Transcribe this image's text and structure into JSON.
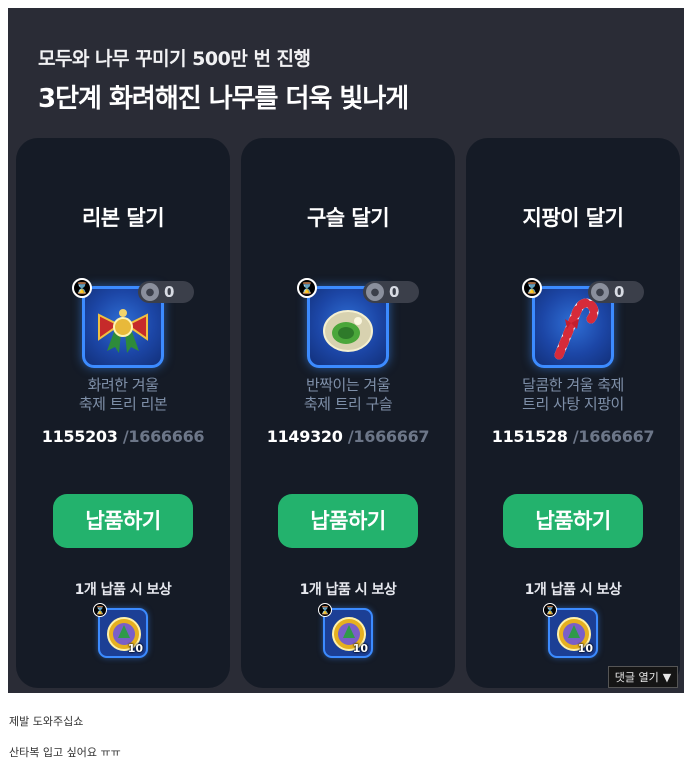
{
  "banner": {
    "subtitle": "모두와 나무 꾸미기 500만 번 진행",
    "title": "3단계 화려해진 나무를 더욱 빛나게"
  },
  "cards": [
    {
      "title": "리본 달기",
      "item_icon": "ribbon-icon",
      "owned_count": "0",
      "item_name_line1": "화려한 겨울",
      "item_name_line2": "축제 트리 리본",
      "current": "1155203",
      "total": "/1666666",
      "button_label": "납품하기",
      "reward_label": "1개 납품 시 보상",
      "reward_qty": "10"
    },
    {
      "title": "구슬 달기",
      "item_icon": "ornament-ball-icon",
      "owned_count": "0",
      "item_name_line1": "반짝이는 겨울",
      "item_name_line2": "축제 트리 구슬",
      "current": "1149320",
      "total": "/1666667",
      "button_label": "납품하기",
      "reward_label": "1개 납품 시 보상",
      "reward_qty": "10"
    },
    {
      "title": "지팡이 달기",
      "item_icon": "candy-cane-icon",
      "owned_count": "0",
      "item_name_line1": "달콤한 겨울 축제",
      "item_name_line2": "트리 사탕 지팡이",
      "current": "1151528",
      "total": "/1666667",
      "button_label": "납품하기",
      "reward_label": "1개 납품 시 보상",
      "reward_qty": "10"
    }
  ],
  "comment_button": {
    "label": "댓글 열기"
  },
  "post": {
    "line1": "제발 도와주십쇼",
    "line2": "산타복 입고 싶어요 ㅠㅠ"
  },
  "colors": {
    "banner_bg": "#2a2c36",
    "card_bg": "#151b26",
    "button_green": "#23b26d",
    "item_frame_blue": "#3c8bff"
  }
}
